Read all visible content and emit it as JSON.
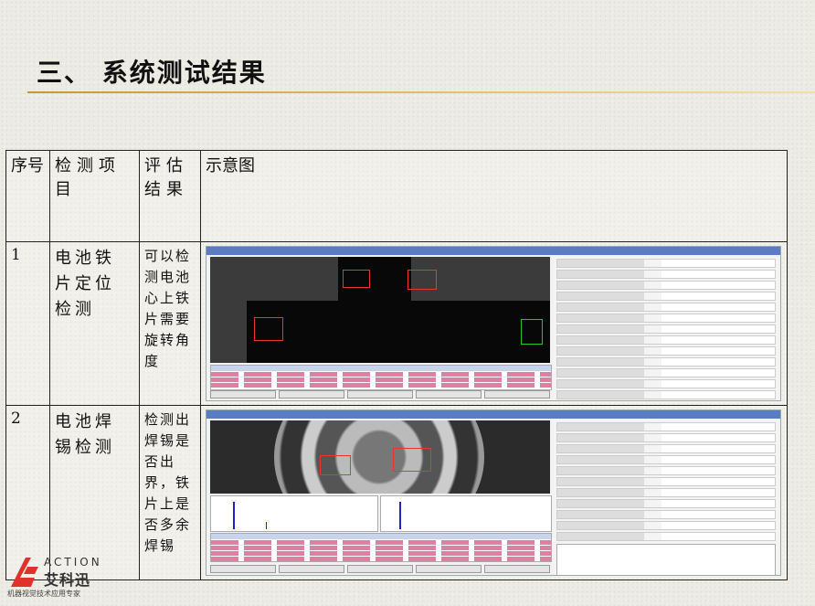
{
  "slide": {
    "title": "三、 系统测试结果"
  },
  "table": {
    "headers": {
      "num": "序号",
      "item": "检测项目",
      "result": "评估结果",
      "image": "示意图"
    },
    "rows": [
      {
        "num": "1",
        "item": "电池铁片定位检测",
        "result": "可以检测电池心上铁片需要旋转角度",
        "image_icon": "battery-plate-positioning-screenshot"
      },
      {
        "num": "2",
        "item": "电池焊锡检测",
        "result": "检测出焊锡是否出界，铁片上是否多余焊锡",
        "image_icon": "battery-solder-inspection-screenshot"
      }
    ]
  },
  "logo": {
    "brand_en": "ACTION",
    "brand_cn": "艾科迅",
    "tagline": "机器视觉技术应用专家",
    "color": "#e0322b"
  }
}
